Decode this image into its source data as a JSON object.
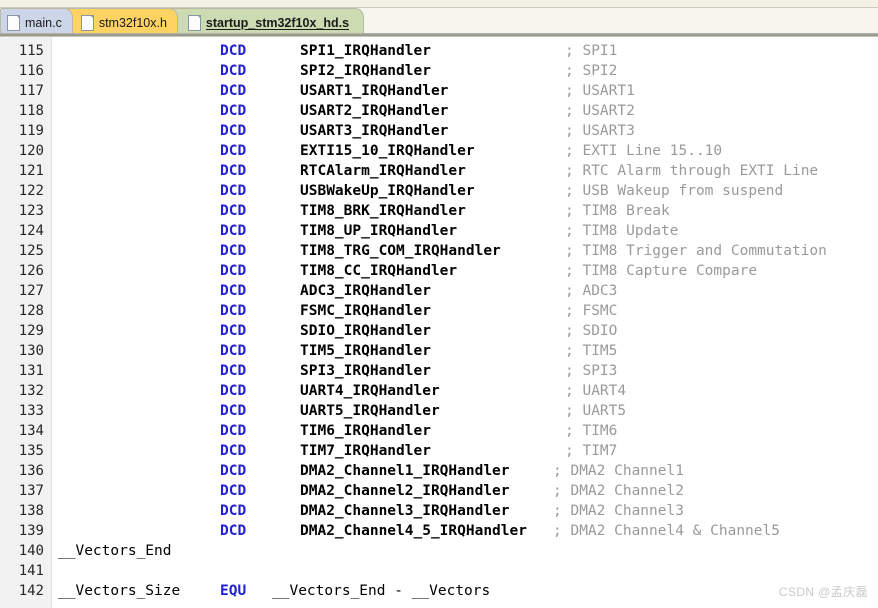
{
  "tabs": [
    {
      "label": "main.c",
      "icon": "file-icon",
      "state": "inactive",
      "color": "#ccd6e8"
    },
    {
      "label": "stm32f10x.h",
      "icon": "file-icon",
      "state": "inactive",
      "color": "#ffd264"
    },
    {
      "label": "startup_stm32f10x_hd.s",
      "icon": "file-icon",
      "state": "active",
      "color": "#cddbb2"
    }
  ],
  "editor": {
    "colors": {
      "keyword": "#2121d4",
      "identifier": "#000000",
      "comment": "#9a9a9a",
      "line_number": "#262626",
      "gutter_background": "#f2f2f2",
      "background": "#ffffff"
    },
    "first_line_number": 115,
    "last_line_number": 142,
    "lines": [
      {
        "n": "115",
        "kw": "DCD",
        "ident": "SPI1_IRQHandler",
        "cmt": "; SPI1"
      },
      {
        "n": "116",
        "kw": "DCD",
        "ident": "SPI2_IRQHandler",
        "cmt": "; SPI2"
      },
      {
        "n": "117",
        "kw": "DCD",
        "ident": "USART1_IRQHandler",
        "cmt": "; USART1"
      },
      {
        "n": "118",
        "kw": "DCD",
        "ident": "USART2_IRQHandler",
        "cmt": "; USART2"
      },
      {
        "n": "119",
        "kw": "DCD",
        "ident": "USART3_IRQHandler",
        "cmt": "; USART3"
      },
      {
        "n": "120",
        "kw": "DCD",
        "ident": "EXTI15_10_IRQHandler",
        "cmt": "; EXTI Line 15..10"
      },
      {
        "n": "121",
        "kw": "DCD",
        "ident": "RTCAlarm_IRQHandler",
        "cmt": "; RTC Alarm through EXTI Line"
      },
      {
        "n": "122",
        "kw": "DCD",
        "ident": "USBWakeUp_IRQHandler",
        "cmt": "; USB Wakeup from suspend"
      },
      {
        "n": "123",
        "kw": "DCD",
        "ident": "TIM8_BRK_IRQHandler",
        "cmt": "; TIM8 Break"
      },
      {
        "n": "124",
        "kw": "DCD",
        "ident": "TIM8_UP_IRQHandler",
        "cmt": "; TIM8 Update"
      },
      {
        "n": "125",
        "kw": "DCD",
        "ident": "TIM8_TRG_COM_IRQHandler",
        "cmt": "; TIM8 Trigger and Commutation"
      },
      {
        "n": "126",
        "kw": "DCD",
        "ident": "TIM8_CC_IRQHandler",
        "cmt": "; TIM8 Capture Compare"
      },
      {
        "n": "127",
        "kw": "DCD",
        "ident": "ADC3_IRQHandler",
        "cmt": "; ADC3"
      },
      {
        "n": "128",
        "kw": "DCD",
        "ident": "FSMC_IRQHandler",
        "cmt": "; FSMC"
      },
      {
        "n": "129",
        "kw": "DCD",
        "ident": "SDIO_IRQHandler",
        "cmt": "; SDIO"
      },
      {
        "n": "130",
        "kw": "DCD",
        "ident": "TIM5_IRQHandler",
        "cmt": "; TIM5"
      },
      {
        "n": "131",
        "kw": "DCD",
        "ident": "SPI3_IRQHandler",
        "cmt": "; SPI3"
      },
      {
        "n": "132",
        "kw": "DCD",
        "ident": "UART4_IRQHandler",
        "cmt": "; UART4"
      },
      {
        "n": "133",
        "kw": "DCD",
        "ident": "UART5_IRQHandler",
        "cmt": "; UART5"
      },
      {
        "n": "134",
        "kw": "DCD",
        "ident": "TIM6_IRQHandler",
        "cmt": "; TIM6"
      },
      {
        "n": "135",
        "kw": "DCD",
        "ident": "TIM7_IRQHandler",
        "cmt": "; TIM7"
      },
      {
        "n": "136",
        "kw": "DCD",
        "ident": "DMA2_Channel1_IRQHandler",
        "cmt": "; DMA2 Channel1",
        "cmt_wide": true
      },
      {
        "n": "137",
        "kw": "DCD",
        "ident": "DMA2_Channel2_IRQHandler",
        "cmt": "; DMA2 Channel2",
        "cmt_wide": true
      },
      {
        "n": "138",
        "kw": "DCD",
        "ident": "DMA2_Channel3_IRQHandler",
        "cmt": "; DMA2 Channel3",
        "cmt_wide": true
      },
      {
        "n": "139",
        "kw": "DCD",
        "ident": "DMA2_Channel4_5_IRQHandler",
        "cmt": "; DMA2 Channel4 & Channel5",
        "cmt_wide": true
      },
      {
        "n": "140",
        "src": "__Vectors_End"
      },
      {
        "n": "141",
        "src": ""
      },
      {
        "n": "142",
        "src_pre": "__Vectors_Size",
        "kw2": "EQU",
        "src_post": "__Vectors_End - __Vectors"
      }
    ]
  },
  "watermark": {
    "text": "CSDN @孟庆磊"
  }
}
